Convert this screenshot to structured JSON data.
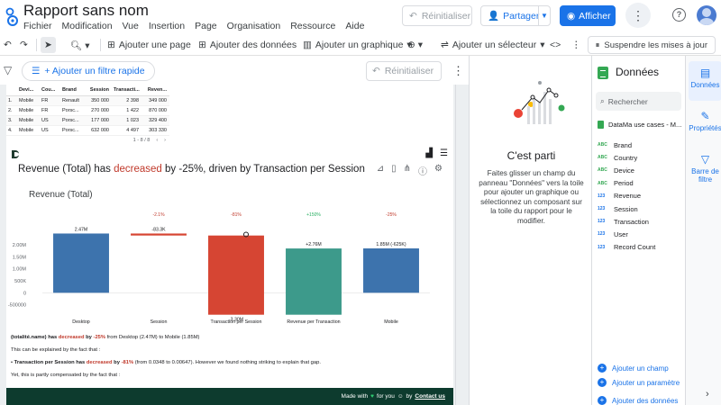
{
  "app": {
    "doc_title": "Rapport sans nom",
    "menus": [
      "Fichier",
      "Modification",
      "Vue",
      "Insertion",
      "Page",
      "Organisation",
      "Ressource",
      "Aide"
    ],
    "reset_label": "Réinitialiser",
    "share_label": "Partager",
    "view_label": "Afficher"
  },
  "toolbar": {
    "add_page": "Ajouter une page",
    "add_data": "Ajouter des données",
    "add_chart": "Ajouter un graphique",
    "add_control": "Ajouter un sélecteur",
    "suspend": "Suspendre les mises à jour"
  },
  "filterbar": {
    "add_filter": "+ Ajouter un filtre rapide",
    "reset": "Réinitialiser"
  },
  "mini_table": {
    "headers": [
      "",
      "Devi...",
      "Cou...",
      "Brand",
      "Session",
      "Transacti...",
      "Reven..."
    ],
    "rows": [
      [
        "1.",
        "Mobile",
        "FR",
        "Renault",
        "350 000",
        "2 398",
        "349 000"
      ],
      [
        "2.",
        "Mobile",
        "FR",
        "Porsc...",
        "270 000",
        "1 422",
        "870 000"
      ],
      [
        "3.",
        "Mobile",
        "US",
        "Porsc...",
        "177 000",
        "1 023",
        "329 400"
      ],
      [
        "4.",
        "Mobile",
        "US",
        "Porsc...",
        "632 000",
        "4 497",
        "303 330"
      ]
    ],
    "pager": "1 - 8 / 8"
  },
  "component": {
    "headline_pre": "Revenue (Total) has ",
    "headline_red": "decreased",
    "headline_post": " by -25%, driven by Transaction per Session",
    "narr1_name": "(totalité.name)",
    "narr1_has": " has ",
    "narr1_red": "decreased",
    "narr1_by": " by ",
    "narr1_pct": "-25%",
    "narr1_rest": " from Desktop (2.47M) to Mobile (1.85M)",
    "narr2": "This can be explained by the fact that :",
    "narr3_bullet": "• ",
    "narr3_name": "Transaction per Session",
    "narr3_has": " has ",
    "narr3_red": "decreased",
    "narr3_by": " by ",
    "narr3_pct": "-81%",
    "narr3_rest": " (from 0.0348 to 0.00647). However we found nothing striking to explain that gap.",
    "narr4": "Yet, this is partly compensated by the fact that :",
    "footer_pre": "Made with",
    "footer_heart": "♥",
    "footer_mid": "for you",
    "footer_link": "Contact us"
  },
  "chart_data": {
    "type": "bar",
    "subtype": "waterfall",
    "title": "Revenue (Total)",
    "categories": [
      "Desktop",
      "Session",
      "Transaction per Session",
      "Revenue per Transaction",
      "Mobile"
    ],
    "values": [
      2.47,
      -0.0833,
      -3.3,
      2.76,
      1.85
    ],
    "value_labels": [
      "2.47M",
      "-83.3K",
      "-3.30M",
      "+2.76M",
      "1.85M (-625K)"
    ],
    "pct_labels": [
      "",
      "-2.1%",
      "-81%",
      "+150%",
      "-25%"
    ],
    "y_tick_labels": [
      "2.00M",
      "1.50M",
      "1.00M",
      "500K",
      "0",
      "-500000"
    ],
    "y_ticks": [
      2.0,
      1.5,
      1.0,
      0.5,
      0,
      -0.5
    ],
    "ylim": [
      -0.7,
      2.75
    ],
    "colors": {
      "total": "#3d73ad",
      "decrease": "#d64533",
      "increase": "#3d9a8b",
      "pct_neg": "#c0392b",
      "pct_pos": "#27ae60"
    }
  },
  "empty_state": {
    "title": "C'est parti",
    "text": "Faites glisser un champ du panneau \"Données\" vers la toile pour ajouter un graphique ou sélectionnez un composant sur la toile du rapport pour le modifier."
  },
  "data_panel": {
    "title": "Données",
    "search_placeholder": "Rechercher",
    "source": "DataMa use cases - M...",
    "fields": [
      {
        "type": "ABC",
        "name": "Brand"
      },
      {
        "type": "ABC",
        "name": "Country"
      },
      {
        "type": "ABC",
        "name": "Device"
      },
      {
        "type": "ABC",
        "name": "Period"
      },
      {
        "type": "123",
        "name": "Revenue"
      },
      {
        "type": "123",
        "name": "Session"
      },
      {
        "type": "123",
        "name": "Transaction"
      },
      {
        "type": "123",
        "name": "User"
      },
      {
        "type": "123",
        "name": "Record Count"
      }
    ],
    "add_field": "Ajouter un champ",
    "add_param": "Ajouter un paramètre",
    "add_data": "Ajouter des données"
  },
  "right_tabs": [
    {
      "label": "Données",
      "icon": "data-icon"
    },
    {
      "label": "Propriétés",
      "icon": "properties-icon"
    },
    {
      "label": "Barre de filtre",
      "icon": "filter-icon"
    }
  ]
}
